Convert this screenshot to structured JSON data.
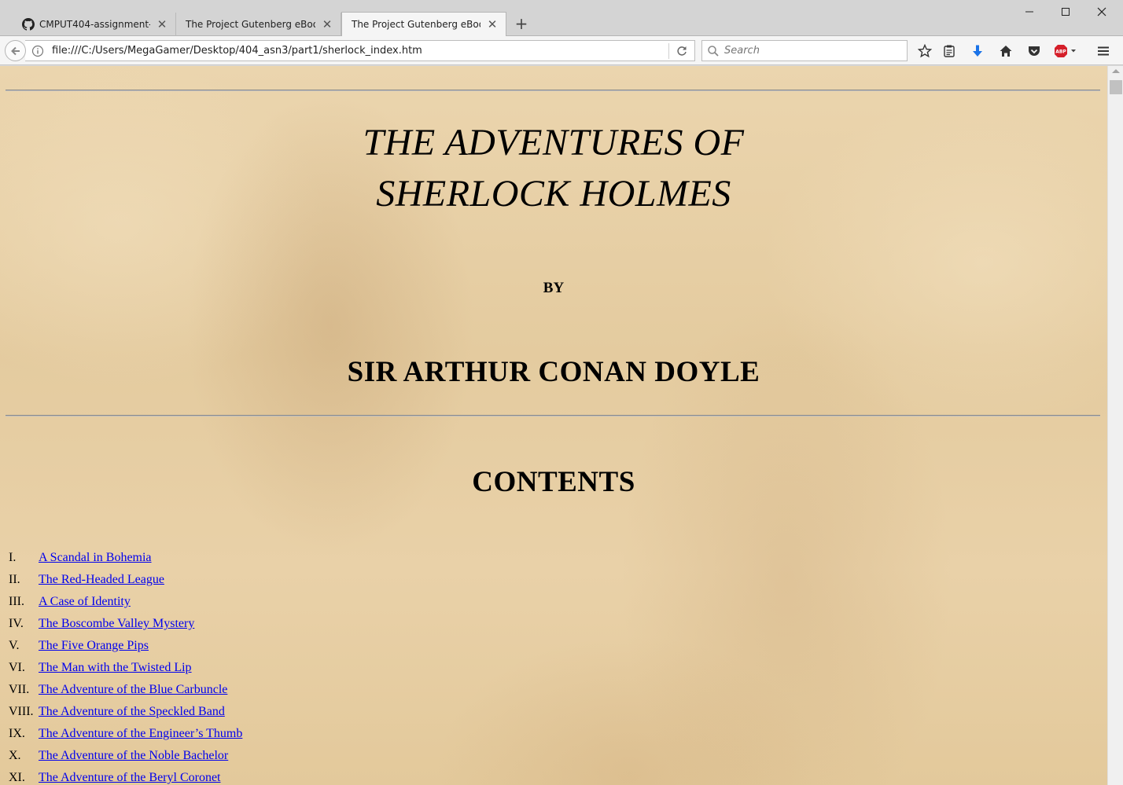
{
  "tabs": [
    {
      "title": "CMPUT404-assignment-c...",
      "icon": "github-icon",
      "active": false
    },
    {
      "title": "The Project Gutenberg eBook ...",
      "icon": "",
      "active": false
    },
    {
      "title": "The Project Gutenberg eBook ...",
      "icon": "",
      "active": true
    }
  ],
  "navbar": {
    "url": "file:///C:/Users/MegaGamer/Desktop/404_asn3/part1/sherlock_index.htm",
    "search_placeholder": "Search"
  },
  "page": {
    "title_line1": "THE ADVENTURES OF",
    "title_line2": "SHERLOCK HOLMES",
    "by": "BY",
    "author": "SIR ARTHUR CONAN DOYLE",
    "contents_heading": "CONTENTS",
    "toc": [
      {
        "num": "I.",
        "title": "A Scandal in Bohemia"
      },
      {
        "num": "II.",
        "title": "The Red-Headed League"
      },
      {
        "num": "III.",
        "title": "A Case of Identity"
      },
      {
        "num": "IV.",
        "title": "The Boscombe Valley Mystery"
      },
      {
        "num": "V.",
        "title": "The Five Orange Pips"
      },
      {
        "num": "VI.",
        "title": "The Man with the Twisted Lip"
      },
      {
        "num": "VII.",
        "title": "The Adventure of the Blue Carbuncle"
      },
      {
        "num": "VIII.",
        "title": "The Adventure of the Speckled Band"
      },
      {
        "num": "IX.",
        "title": "The Adventure of the Engineer’s Thumb"
      },
      {
        "num": "X.",
        "title": "The Adventure of the Noble Bachelor"
      },
      {
        "num": "XI.",
        "title": "The Adventure of the Beryl Coronet"
      }
    ]
  },
  "colors": {
    "link": "#0000ee",
    "page_background": "#e9d3ac",
    "download_icon": "#1a73e8",
    "adblock_icon": "#d51f2a"
  }
}
